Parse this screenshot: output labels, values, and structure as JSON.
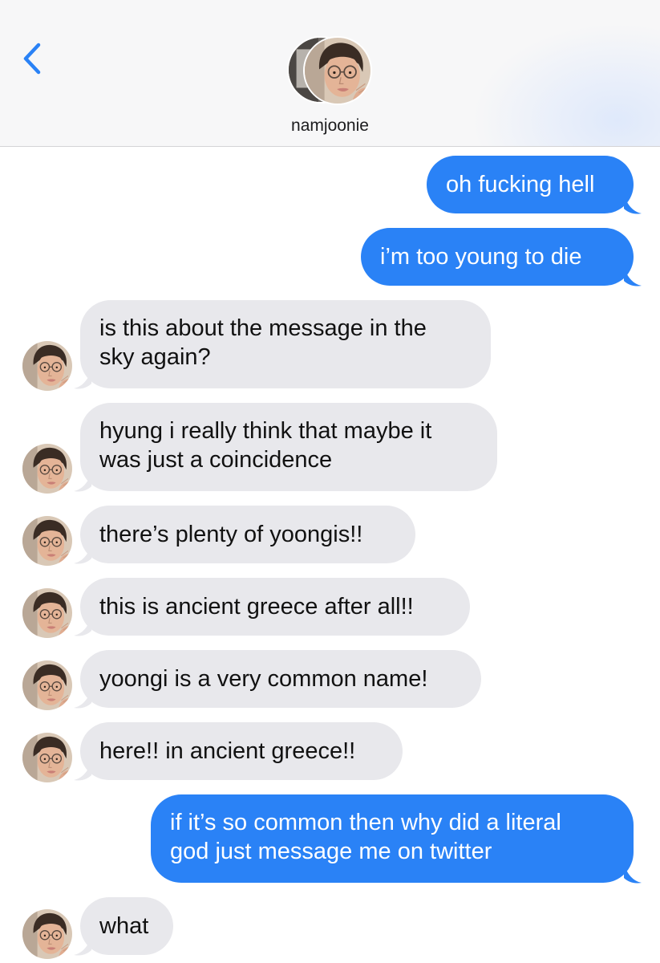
{
  "header": {
    "contact_name": "namjoonie",
    "back_icon": "chevron-left-icon",
    "accent_color": "#2a82f6"
  },
  "messages": [
    {
      "direction": "outgoing",
      "lines": [
        "oh fucking hell"
      ]
    },
    {
      "direction": "outgoing",
      "lines": [
        "i’m too young to die"
      ]
    },
    {
      "direction": "incoming",
      "lines": [
        "is this about the message in the",
        "sky again?"
      ]
    },
    {
      "direction": "incoming",
      "lines": [
        "hyung i really think that maybe it",
        "was just a coincidence"
      ]
    },
    {
      "direction": "incoming",
      "lines": [
        "there’s plenty of yoongis!!"
      ]
    },
    {
      "direction": "incoming",
      "lines": [
        "this is ancient greece after all!!"
      ]
    },
    {
      "direction": "incoming",
      "lines": [
        "yoongi is a very common name!"
      ]
    },
    {
      "direction": "incoming",
      "lines": [
        "here!! in ancient greece!!"
      ]
    },
    {
      "direction": "outgoing",
      "lines": [
        "if it’s so common then why did a literal",
        "god just message me on twitter"
      ]
    },
    {
      "direction": "incoming",
      "lines": [
        "what"
      ]
    }
  ],
  "colors": {
    "outgoing_bubble": "#2a82f6",
    "incoming_bubble": "#e8e8ec"
  }
}
